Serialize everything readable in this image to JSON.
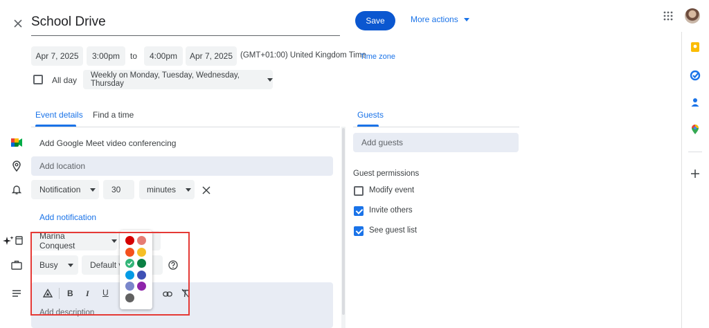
{
  "header": {
    "title": "School Drive",
    "save_label": "Save",
    "more_actions_label": "More actions"
  },
  "datetime": {
    "start_date": "Apr 7, 2025",
    "start_time": "3:00pm",
    "to_label": "to",
    "end_time": "4:00pm",
    "end_date": "Apr 7, 2025",
    "timezone_text": "(GMT+01:00) United Kingdom Time",
    "timezone_link": "Time zone",
    "all_day_label": "All day",
    "recurrence": "Weekly on Monday, Tuesday, Wednesday, Thursday"
  },
  "tabs": {
    "event_details": "Event details",
    "find_time": "Find a time",
    "guests": "Guests"
  },
  "details": {
    "meet": "Add Google Meet video conferencing",
    "location_placeholder": "Add location",
    "notification_type": "Notification",
    "notification_value": "30",
    "notification_unit": "minutes",
    "add_notification": "Add notification",
    "calendar": "Marina Conquest",
    "busy": "Busy",
    "visibility": "Default visibility",
    "description_placeholder": "Add description"
  },
  "guests": {
    "placeholder": "Add guests",
    "permissions_title": "Guest permissions",
    "permissions": [
      {
        "label": "Modify event",
        "checked": false
      },
      {
        "label": "Invite others",
        "checked": true
      },
      {
        "label": "See guest list",
        "checked": true
      }
    ]
  },
  "colors": {
    "accent": "#1a73e8",
    "palette": [
      "#d50000",
      "#e67c73",
      "#f4511e",
      "#f6bf26",
      "#33b679",
      "#0b8043",
      "#039be5",
      "#3f51b5",
      "#7986cb",
      "#8e24aa",
      "#616161"
    ],
    "selected_index": 4,
    "highlight_border": "#e53935"
  },
  "icons": {
    "close": "close-icon",
    "apps": "apps-grid-icon",
    "avatar": "user-avatar",
    "meet": "google-meet-icon",
    "location": "location-pin-icon",
    "notification": "bell-icon",
    "calendar": "calendar-sparkle-icon",
    "busy": "briefcase-icon",
    "description": "description-lines-icon",
    "help": "help-circle-icon"
  }
}
